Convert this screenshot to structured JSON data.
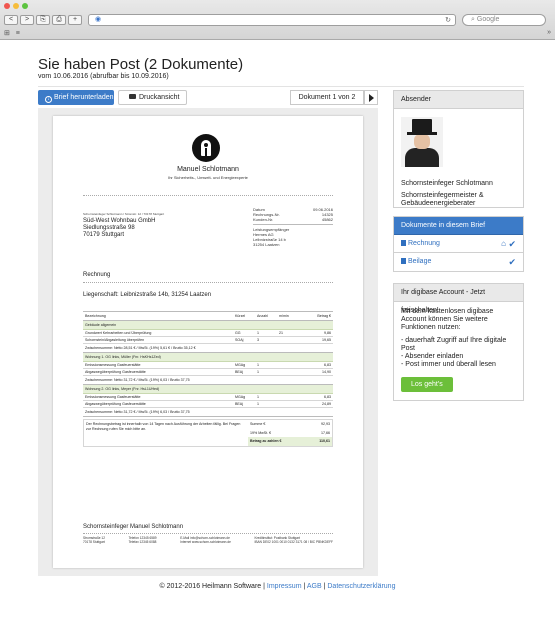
{
  "browser": {
    "address": "",
    "search_placeholder": "Google",
    "nav": {
      "back": "<",
      "forward": ">"
    }
  },
  "page": {
    "title": "Sie haben Post (2 Dokumente)",
    "subtitle": "vom 10.06.2016 (abrufbar bis 10.09.2016)"
  },
  "toolbar": {
    "download_label": "Brief herunterladen",
    "print_label": "Druckansicht",
    "counter": "Dokument 1 von 2"
  },
  "letter": {
    "issuer_name": "Manuel Schlotmann",
    "issuer_tagline": "Ihr Sicherheits-, Umwelt- und Energieexperte",
    "sender_line": "Schornsteinfeger Schlotmann / Stromstr. 12 / 70178 Stuttgart",
    "recipient": [
      "Süd-West Wohnbau GmbH",
      "Siedlungsstraße 98",
      "70179 Stuttgart"
    ],
    "meta": [
      {
        "label": "Datum",
        "value": "09.06.2016"
      },
      {
        "label": "Rechnungs-Nr.",
        "value": "14325"
      },
      {
        "label": "Kunden-Nr.",
        "value": "45862"
      }
    ],
    "recipient_service": [
      "Leistungsempfänger",
      "Hermes AG",
      "Leibnizstraße 14 b",
      "31254 Laatzen"
    ],
    "heading": "Rechnung",
    "property": "Liegenschaft: Leibnizstraße 14b, 31254 Laatzen",
    "table": {
      "headers": [
        "Bezeichnung",
        "Kürzel",
        "Anzahl",
        "m/min",
        "Betrag €"
      ],
      "groups": [
        {
          "title": "Gebäude allgemein",
          "rows": [
            {
              "desc": "Grundwert Kehrarbeiten und Überprüfung",
              "code": "GG",
              "qty": "1",
              "unit": "21",
              "amount": "9,86"
            },
            {
              "desc": "Schornstein/Abgasleitung überprüfen",
              "code": "SOAj",
              "qty": "3",
              "unit": "",
              "amount": "19,65"
            }
          ],
          "subtotal": "Zwischensumme: Netto 28,51 € / MwSt. (19%) 5,61 € / Brutto 35,12 €"
        },
        {
          "title": "Wohnung 1. OG links, Müller (Fnr. HsKHs1Zed)",
          "rows": [
            {
              "desc": "Emissionsmessung Gasfeuerstätte",
              "code": "MGAg",
              "qty": "1",
              "unit": "",
              "amount": "6,83"
            },
            {
              "desc": "Abgaswegüberprüfung Gasfeuerstätte",
              "code": "BEAj",
              "qty": "1",
              "unit": "",
              "amount": "14,90"
            }
          ],
          "subtotal": "Zwischensumme: Netto 31,72 € / MwSt. (19%) 6,03 / Brutto 37,75"
        },
        {
          "title": "Wohnung 2. OG links, Meyer (Fnr. HsL1UHed)",
          "rows": [
            {
              "desc": "Emissionsmessung Gasfeuerstätte",
              "code": "MGAg",
              "qty": "1",
              "unit": "",
              "amount": "6,83"
            },
            {
              "desc": "Abgaswegüberprüfung Gasfeuerstätte",
              "code": "BEAj",
              "qty": "1",
              "unit": "",
              "amount": "24,89"
            }
          ],
          "subtotal": "Zwischensumme: Netto 31,72 € / MwSt. (19%) 6,03 / Brutto 37,75"
        }
      ],
      "note": "Der Rechnungsbetrag ist innerhalb von 14 Tagen nach Ausführung der Arbeiten fällig. Bei Fragen zur Rechnung rufen Sie mich bitte an.",
      "totals": [
        {
          "label": "Summe €",
          "value": "92,93"
        },
        {
          "label": "19% MwSt. €",
          "value": "17,66"
        },
        {
          "label": "Betrag zu zahlen €",
          "value": "110,61"
        }
      ]
    },
    "footer_name": "Schornsteinfeger Manuel Schlotmann",
    "footer_cols": [
      [
        "Stromstraße 12",
        "70178 Stuttgart"
      ],
      [
        "Telefon 12345 6589",
        "Telefax 12345 6088"
      ],
      [
        "E-Mail info@schorn-schlotmann.de",
        "Internet www.schorn-schlotmann.de"
      ],
      [
        "Kreditinstitut: Postbank Stuttgart",
        "IBAN DE02 1001 0010 0132 3171 08 / BIC PBNKDEFF"
      ]
    ]
  },
  "sidebar": {
    "sender": {
      "heading": "Absender",
      "name": "Schornsteinfeger Schlotmann",
      "role": "Schornsteinfegermeister & Gebäudeenergieberater"
    },
    "documents": {
      "heading": "Dokumente in diesem Brief",
      "items": [
        {
          "label": "Rechnung",
          "icons": [
            "home-icon",
            "check-icon"
          ]
        },
        {
          "label": "Beilage",
          "icons": [
            "check-icon"
          ]
        }
      ]
    },
    "promo": {
      "heading": "Ihr digibase Account - Jetzt freischalten!",
      "text": "Mit dem kostenlosen digibase Account können Sie weitere Funktionen nutzen:",
      "bullets": [
        "- dauerhaft Zugriff auf Ihre digitale Post",
        "- Absender einladen",
        "- Post immer und überall lesen"
      ],
      "button": "Los geht's"
    }
  },
  "footer": {
    "copyright": "© 2012-2016 Heilmann Software |",
    "links": [
      "Impressum",
      "AGB",
      "Datenschutzerklärung"
    ]
  },
  "colors": {
    "primary": "#3c7bc8",
    "success": "#6cbf3a",
    "table_group": "#e6f0d8"
  }
}
